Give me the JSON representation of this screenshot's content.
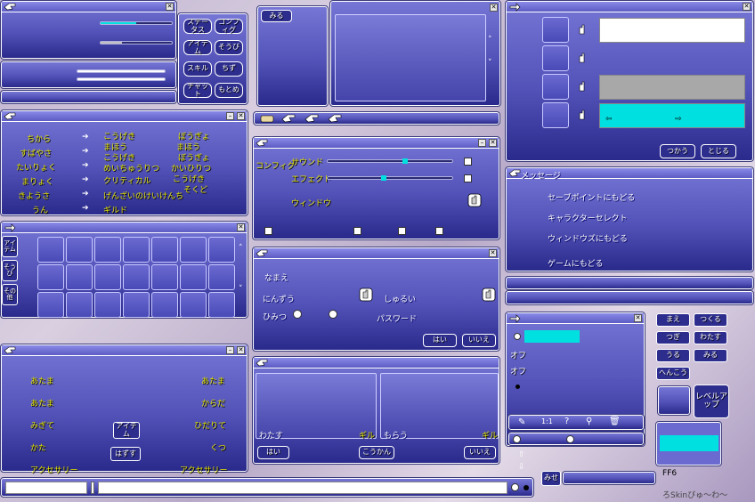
{
  "status_menu": {
    "buttons": [
      "ステータス",
      "コンフィグ",
      "アイテム",
      "そうび",
      "スキル",
      "ちず",
      "チャット",
      "もとめ"
    ]
  },
  "top_middle": {
    "view_label": "みる"
  },
  "status_window": {
    "rows": [
      {
        "name": "ちから",
        "value": "こうげき",
        "extra": "ぼうぎょ"
      },
      {
        "name": "すばやさ",
        "value": "まほう",
        "extra": "まほう"
      },
      {
        "name": "たいりょく",
        "value": "こうげき",
        "extra": "ぼうぎょ"
      },
      {
        "name": "まりょく",
        "value": "めいちゅうりつ",
        "extra": "かいひりつ"
      },
      {
        "name": "きようさ",
        "value": "クリティカル",
        "extra": "こうげき"
      },
      {
        "name": "うん",
        "value": "げんざいのけいけんち",
        "extra": "そくど"
      },
      {
        "name": "",
        "value": "ギルド",
        "extra": ""
      }
    ]
  },
  "inventory": {
    "tabs": [
      "アイテム",
      "そうび",
      "その他"
    ]
  },
  "equip_window": {
    "left_slots": [
      "あたま",
      "あたま",
      "みぎて",
      "かた",
      "アクセサリー"
    ],
    "right_slots": [
      "あたま",
      "からだ",
      "ひだりて",
      "くつ",
      "アクセサリー"
    ],
    "item_button": "アイテム",
    "remove_button": "はずす"
  },
  "config_window": {
    "tabs": [
      "コンフィグ",
      "エフェクト"
    ],
    "rows": [
      "サウンド",
      "エフェクト",
      "ウィンドウ"
    ]
  },
  "char_make": {
    "name_label": "なまえ",
    "people_label": "にんずう",
    "type_label": "しゅるい",
    "secret_label": "ひみつ",
    "password_label": "パスワード",
    "yes_button": "はい",
    "no_button": "いいえ"
  },
  "trade_window": {
    "give_label": "わたす",
    "receive_label": "もらう",
    "gil_label": "ギル",
    "yes_button": "はい",
    "exchange_button": "こうかん",
    "no_button": "いいえ"
  },
  "message_window": {
    "title": "メッセージ",
    "items": [
      "セーブポイントにもどる",
      "キャラクターセレクト",
      "ウィンドウズにもどる",
      "ゲームにもどる"
    ]
  },
  "shop_window": {
    "use_button": "つかう",
    "close_button": "とじる"
  },
  "options_window": {
    "off_label_1": "オフ",
    "off_label_2": "オフ"
  },
  "action_buttons": [
    "まえ",
    "つくる",
    "つぎ",
    "わたす",
    "うる",
    "みる",
    "へんこう"
  ],
  "level_up_button": "レベルアップ",
  "bottom_right": {
    "ok_button": "みせ",
    "color_label": "FF6",
    "skin_label": "ろSkinぴゅ〜わ〜"
  },
  "colors": {
    "accent_cyan": "#00e0e0",
    "window_top": "#7676d6",
    "window_bottom": "#2a2a8c"
  }
}
